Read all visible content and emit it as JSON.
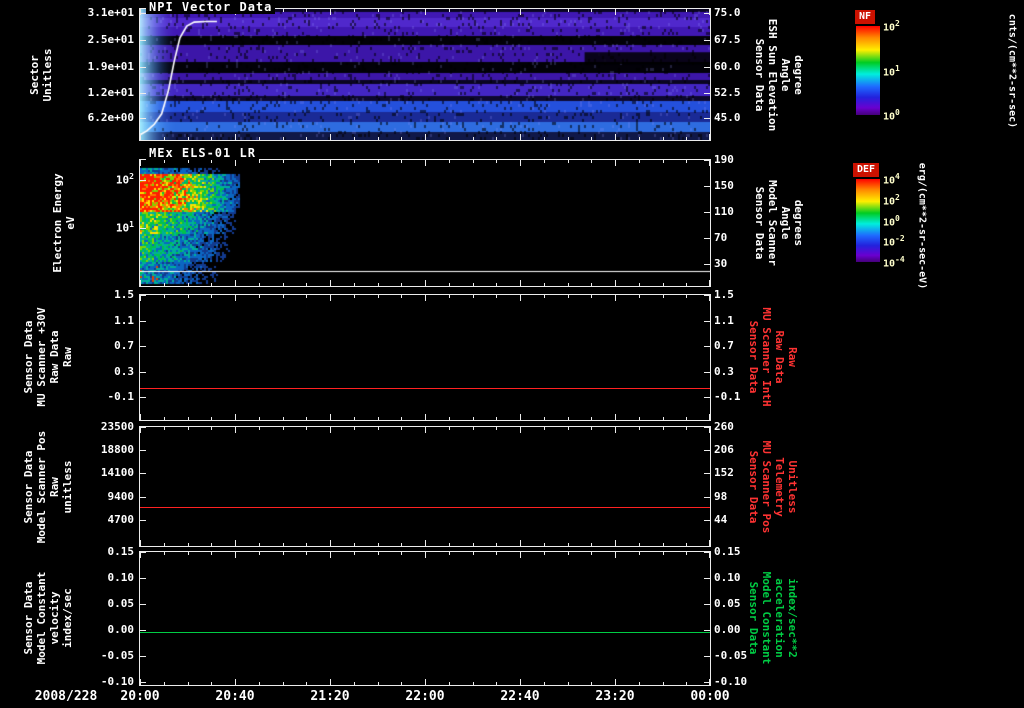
{
  "page": {
    "background": "#000000",
    "text_color": "#ffffff"
  },
  "chart_data": {
    "type": "multi-panel-timeseries",
    "xaxis": {
      "date_label": "2008/228",
      "tick_labels": [
        "20:00",
        "20:40",
        "21:20",
        "22:00",
        "22:40",
        "23:20",
        "00:00"
      ]
    },
    "panels": [
      {
        "id": "npi",
        "type": "heatmap",
        "title": "NPI Vector Data",
        "left_label_lines": [
          "Sector",
          "Unitless"
        ],
        "right_label_lines": [
          "Sensor Data",
          "ESH Sun Elevation",
          "Angle",
          "degree"
        ],
        "right_label_color": "#ffffff",
        "yticks_left": [
          {
            "label": "3.1e+01",
            "frac": 0.03
          },
          {
            "label": "2.5e+01",
            "frac": 0.235
          },
          {
            "label": "1.9e+01",
            "frac": 0.44
          },
          {
            "label": "1.2e+01",
            "frac": 0.64
          },
          {
            "label": "6.2e+00",
            "frac": 0.835
          }
        ],
        "yticks_right": [
          {
            "label": "75.0",
            "frac": 0.03
          },
          {
            "label": "67.5",
            "frac": 0.235
          },
          {
            "label": "60.0",
            "frac": 0.44
          },
          {
            "label": "52.5",
            "frac": 0.64
          },
          {
            "label": "45.0",
            "frac": 0.835
          }
        ],
        "bands": [
          {
            "from": 0.0,
            "to": 0.025,
            "color": "#0a0522"
          },
          {
            "from": 0.025,
            "to": 0.21,
            "color": "#4018b4"
          },
          {
            "from": 0.075,
            "to": 0.135,
            "color": "#5028cc"
          },
          {
            "from": 0.21,
            "to": 0.275,
            "color": "#020108"
          },
          {
            "from": 0.275,
            "to": 0.41,
            "color": "#3c16a8"
          },
          {
            "from": 0.41,
            "to": 0.49,
            "color": "#020108"
          },
          {
            "from": 0.49,
            "to": 0.545,
            "color": "#3c16a8"
          },
          {
            "from": 0.545,
            "to": 0.575,
            "color": "#0a0522"
          },
          {
            "from": 0.575,
            "to": 0.67,
            "color": "#4326c4"
          },
          {
            "from": 0.67,
            "to": 0.705,
            "color": "#0d0830"
          },
          {
            "from": 0.705,
            "to": 0.79,
            "color": "#2450dc"
          },
          {
            "from": 0.79,
            "to": 0.865,
            "color": "#1a2a96"
          },
          {
            "from": 0.865,
            "to": 0.945,
            "color": "#2e6ce0"
          },
          {
            "from": 0.945,
            "to": 1.0,
            "color": "#101848"
          }
        ],
        "dark_patches": [
          {
            "x0": 0.78,
            "x1": 1.0,
            "y0": 0.33,
            "y1": 0.42
          }
        ],
        "left_patch": {
          "width_frac": 0.068,
          "color_strong": "rgba(150,235,255,0.95)",
          "color_soft": "rgba(70,140,255,0.35)"
        },
        "overlay_curve": {
          "color": "#ffffff",
          "points": [
            [
              0,
              0.96
            ],
            [
              0.012,
              0.93
            ],
            [
              0.025,
              0.88
            ],
            [
              0.038,
              0.8
            ],
            [
              0.05,
              0.62
            ],
            [
              0.06,
              0.4
            ],
            [
              0.07,
              0.22
            ],
            [
              0.082,
              0.13
            ],
            [
              0.095,
              0.1
            ],
            [
              0.115,
              0.095
            ],
            [
              0.135,
              0.095
            ]
          ]
        }
      },
      {
        "id": "els",
        "type": "heatmap",
        "title": "MEx ELS-01 LR",
        "left_label_lines": [
          "Electron Energy",
          "eV"
        ],
        "right_label_lines": [
          "Sensor Data",
          "Model Scanner",
          "Angle",
          "degrees"
        ],
        "right_label_color": "#ffffff",
        "yticks_left": [
          {
            "label": "10^2",
            "frac": 0.16
          },
          {
            "label": "10^1",
            "frac": 0.54
          }
        ],
        "yticks_right": [
          {
            "label": "190",
            "frac": 0.0
          },
          {
            "label": "150",
            "frac": 0.206
          },
          {
            "label": "110",
            "frac": 0.413
          },
          {
            "label": "70",
            "frac": 0.619
          },
          {
            "label": "30",
            "frac": 0.825
          }
        ],
        "blob": {
          "width_frac": 0.175
        },
        "white_line_frac": 0.88
      },
      {
        "id": "mu-scanner-30v",
        "type": "line",
        "left_label_lines": [
          "Sensor Data",
          "MU Scanner +30V",
          "Raw Data",
          "Raw"
        ],
        "right_label_lines": [
          "Sensor Data",
          "MU Scanner IntH",
          "Raw Data",
          "Raw"
        ],
        "right_label_color": "#ff3333",
        "yticks_left": [
          {
            "label": "1.5",
            "frac": 0.0
          },
          {
            "label": "1.1",
            "frac": 0.208
          },
          {
            "label": "0.7",
            "frac": 0.408
          },
          {
            "label": "0.3",
            "frac": 0.616
          },
          {
            "label": "-0.1",
            "frac": 0.816
          }
        ],
        "yticks_right": [
          {
            "label": "1.5",
            "frac": 0.0
          },
          {
            "label": "1.1",
            "frac": 0.208
          },
          {
            "label": "0.7",
            "frac": 0.408
          },
          {
            "label": "0.3",
            "frac": 0.616
          },
          {
            "label": "-0.1",
            "frac": 0.816
          }
        ],
        "line": {
          "color": "#ff2222",
          "value": 0.0,
          "frac": 0.74
        }
      },
      {
        "id": "scanner-pos",
        "type": "line",
        "left_label_lines": [
          "Sensor Data",
          "Model Scanner Pos",
          "Raw",
          "unitless"
        ],
        "right_label_lines": [
          "Sensor Data",
          "MU Scanner Pos",
          "Telemetry",
          "Unitless"
        ],
        "right_label_color": "#ff3333",
        "yticks_left": [
          {
            "label": "23500",
            "frac": 0.0
          },
          {
            "label": "18800",
            "frac": 0.195
          },
          {
            "label": "14100",
            "frac": 0.39
          },
          {
            "label": "9400",
            "frac": 0.585
          },
          {
            "label": "4700",
            "frac": 0.78
          }
        ],
        "yticks_right": [
          {
            "label": "260",
            "frac": 0.0
          },
          {
            "label": "206",
            "frac": 0.195
          },
          {
            "label": "152",
            "frac": 0.39
          },
          {
            "label": "98",
            "frac": 0.585
          },
          {
            "label": "44",
            "frac": 0.78
          }
        ],
        "line": {
          "color": "#ff2222",
          "value": 7700,
          "frac": 0.672
        }
      },
      {
        "id": "model-constant",
        "type": "line",
        "left_label_lines": [
          "Sensor Data",
          "Model Constant",
          "velocity",
          "index/sec"
        ],
        "right_label_lines": [
          "Sensor Data",
          "Model Constant",
          "acceleration",
          "index/sec**2"
        ],
        "right_label_color": "#00cc44",
        "yticks_left": [
          {
            "label": "0.15",
            "frac": 0.0
          },
          {
            "label": "0.10",
            "frac": 0.195
          },
          {
            "label": "0.05",
            "frac": 0.39
          },
          {
            "label": "0.00",
            "frac": 0.585
          },
          {
            "label": "-0.05",
            "frac": 0.78
          },
          {
            "label": "-0.10",
            "frac": 0.975
          }
        ],
        "yticks_right": [
          {
            "label": "0.15",
            "frac": 0.0
          },
          {
            "label": "0.10",
            "frac": 0.195
          },
          {
            "label": "0.05",
            "frac": 0.39
          },
          {
            "label": "0.00",
            "frac": 0.585
          },
          {
            "label": "-0.05",
            "frac": 0.78
          },
          {
            "label": "-0.10",
            "frac": 0.975
          }
        ],
        "line": {
          "color": "#00cc44",
          "value": 0.0,
          "frac": 0.6
        }
      }
    ],
    "colorbars": [
      {
        "label": "NF",
        "units": "cnts/(cm**2-sr-sec)",
        "ticks": [
          "10^2",
          "10^1",
          "10^0"
        ],
        "stops": [
          [
            "#ff0000",
            0
          ],
          [
            "#ff8800",
            0.13
          ],
          [
            "#ffee00",
            0.27
          ],
          [
            "#00cc22",
            0.41
          ],
          [
            "#00eedd",
            0.54
          ],
          [
            "#1e6bff",
            0.68
          ],
          [
            "#2222dd",
            0.8
          ],
          [
            "#6a00d0",
            0.92
          ],
          [
            "#45007a",
            1
          ]
        ]
      },
      {
        "label": "DEF",
        "units": "erg/(cm**2-sr-sec-eV)",
        "ticks": [
          "10^4",
          "10^2",
          "10^0",
          "10^-2",
          "10^-4"
        ],
        "stops": [
          [
            "#ff0000",
            0
          ],
          [
            "#ff8800",
            0.13
          ],
          [
            "#ffee00",
            0.27
          ],
          [
            "#00cc22",
            0.41
          ],
          [
            "#00eedd",
            0.54
          ],
          [
            "#1e6bff",
            0.68
          ],
          [
            "#2222dd",
            0.8
          ],
          [
            "#6a00d0",
            0.92
          ],
          [
            "#45007a",
            1
          ]
        ]
      }
    ]
  }
}
